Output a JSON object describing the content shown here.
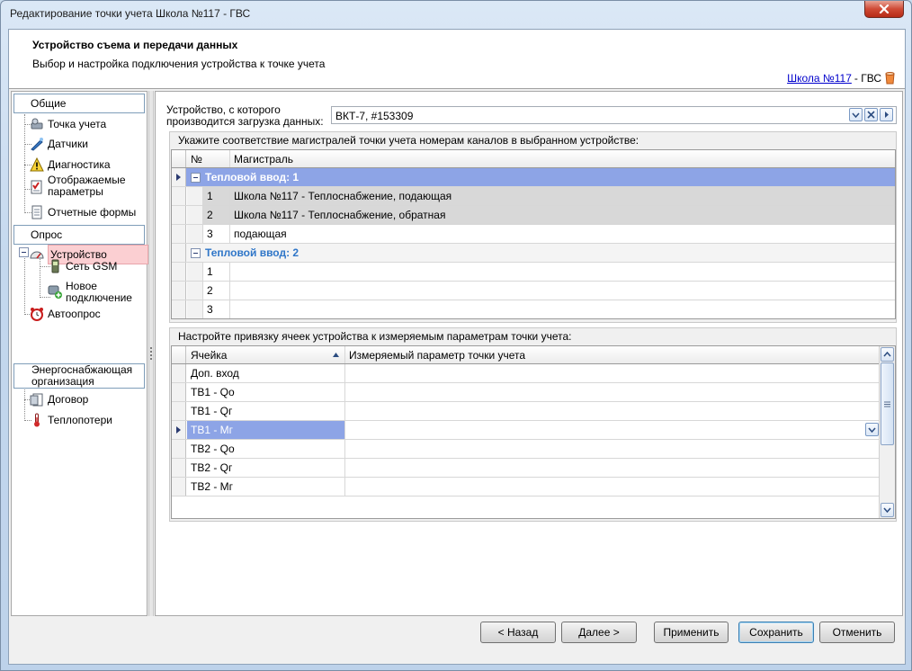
{
  "window": {
    "title": "Редактирование точки учета Школа №117 - ГВС"
  },
  "header": {
    "title": "Устройство съема и передачи данных",
    "subtitle": "Выбор и настройка подключения устройства к точке учета",
    "crumb_link": "Школа №117",
    "crumb_suffix": " - ГВС"
  },
  "nav": {
    "groups": [
      "Общие",
      "Опрос",
      "Энергоснабжающая организация"
    ],
    "general": [
      "Точка учета",
      "Датчики",
      "Диагностика",
      "Отображаемые параметры",
      "Отчетные формы"
    ],
    "polling": [
      "Устройство",
      "Сеть GSM",
      "Новое подключение",
      "Автоопрос"
    ],
    "supplier": [
      "Договор",
      "Теплопотери"
    ]
  },
  "device": {
    "label": "Устройство, с которого производится загрузка данных:",
    "value": "ВКТ-7, #153309"
  },
  "channels": {
    "caption": "Укажите соответствие магистралей точки учета номерам каналов в выбранном устройстве:",
    "columns": [
      "№",
      "Магистраль"
    ],
    "groups": [
      {
        "title": "Тепловой ввод: 1",
        "rows": [
          [
            "1",
            "Школа №117 - Теплоснабжение, подающая"
          ],
          [
            "2",
            "Школа №117 - Теплоснабжение, обратная"
          ],
          [
            "3",
            "подающая"
          ]
        ]
      },
      {
        "title": "Тепловой ввод: 2",
        "rows": [
          [
            "1",
            ""
          ],
          [
            "2",
            ""
          ],
          [
            "3",
            ""
          ]
        ]
      }
    ]
  },
  "cells": {
    "caption": "Настройте привязку ячеек устройства к измеряемым параметрам точки учета:",
    "columns": [
      "Ячейка",
      "Измеряемый параметр точки учета"
    ],
    "rows": [
      "Доп. вход",
      "ТВ1 - Qo",
      "ТВ1 - Qг",
      "ТВ1 - Mг",
      "ТВ2 - Qo",
      "ТВ2 - Qг",
      "ТВ2 - Mг"
    ],
    "selected_index": 3
  },
  "buttons": {
    "back": "< Назад",
    "next": "Далее >",
    "apply": "Применить",
    "save": "Сохранить",
    "cancel": "Отменить"
  }
}
